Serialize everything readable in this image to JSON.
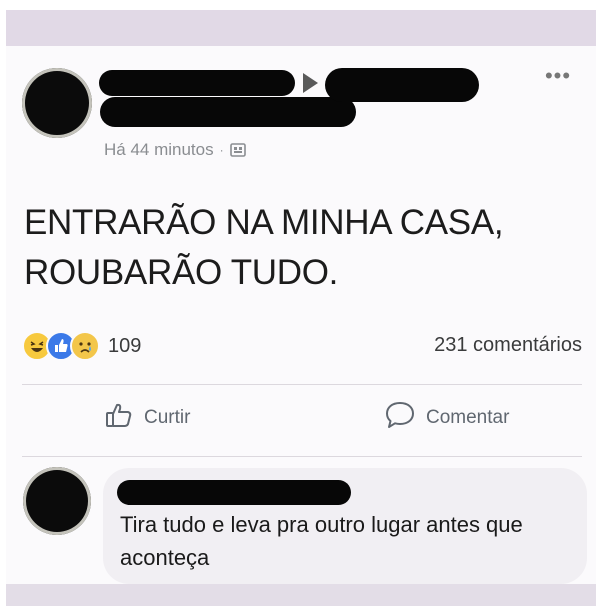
{
  "post": {
    "timestamp": "Há 44 minutos",
    "separator": "·",
    "audience_icon": "public-audience-icon",
    "text": "ENTRARÃO NA MINHA CASA,\nROUBARÃO TUDO.",
    "more_label": "•••"
  },
  "reactions": {
    "types": [
      "haha",
      "like",
      "sad"
    ],
    "count": "109"
  },
  "comments": {
    "count_label": "231 comentários"
  },
  "actions": {
    "like_label": "Curtir",
    "comment_label": "Comentar"
  },
  "comment": {
    "text": "Tira tudo e leva pra outro lugar antes que aconteça"
  },
  "colors": {
    "band": "#e1d9e6",
    "redaction": "#070707",
    "meta_text": "#8a8d91",
    "like_blue": "#3b79e8",
    "reaction_yellow": "#f7c93e"
  }
}
